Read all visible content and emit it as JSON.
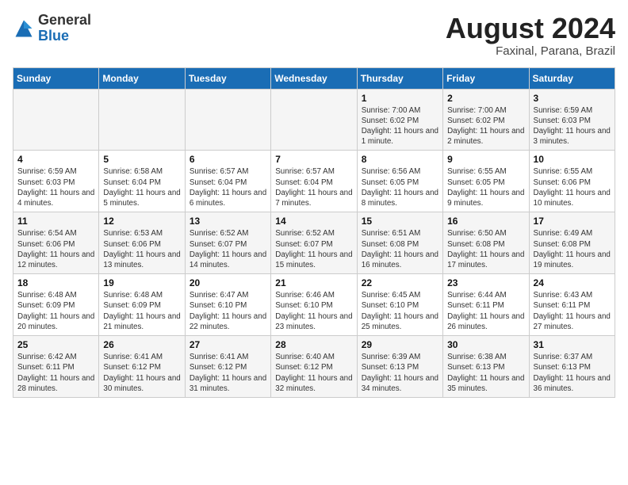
{
  "header": {
    "logo_general": "General",
    "logo_blue": "Blue",
    "title": "August 2024",
    "subtitle": "Faxinal, Parana, Brazil"
  },
  "days_of_week": [
    "Sunday",
    "Monday",
    "Tuesday",
    "Wednesday",
    "Thursday",
    "Friday",
    "Saturday"
  ],
  "weeks": [
    [
      {
        "day": "",
        "info": ""
      },
      {
        "day": "",
        "info": ""
      },
      {
        "day": "",
        "info": ""
      },
      {
        "day": "",
        "info": ""
      },
      {
        "day": "1",
        "info": "Sunrise: 7:00 AM\nSunset: 6:02 PM\nDaylight: 11 hours and 1 minute."
      },
      {
        "day": "2",
        "info": "Sunrise: 7:00 AM\nSunset: 6:02 PM\nDaylight: 11 hours and 2 minutes."
      },
      {
        "day": "3",
        "info": "Sunrise: 6:59 AM\nSunset: 6:03 PM\nDaylight: 11 hours and 3 minutes."
      }
    ],
    [
      {
        "day": "4",
        "info": "Sunrise: 6:59 AM\nSunset: 6:03 PM\nDaylight: 11 hours and 4 minutes."
      },
      {
        "day": "5",
        "info": "Sunrise: 6:58 AM\nSunset: 6:04 PM\nDaylight: 11 hours and 5 minutes."
      },
      {
        "day": "6",
        "info": "Sunrise: 6:57 AM\nSunset: 6:04 PM\nDaylight: 11 hours and 6 minutes."
      },
      {
        "day": "7",
        "info": "Sunrise: 6:57 AM\nSunset: 6:04 PM\nDaylight: 11 hours and 7 minutes."
      },
      {
        "day": "8",
        "info": "Sunrise: 6:56 AM\nSunset: 6:05 PM\nDaylight: 11 hours and 8 minutes."
      },
      {
        "day": "9",
        "info": "Sunrise: 6:55 AM\nSunset: 6:05 PM\nDaylight: 11 hours and 9 minutes."
      },
      {
        "day": "10",
        "info": "Sunrise: 6:55 AM\nSunset: 6:06 PM\nDaylight: 11 hours and 10 minutes."
      }
    ],
    [
      {
        "day": "11",
        "info": "Sunrise: 6:54 AM\nSunset: 6:06 PM\nDaylight: 11 hours and 12 minutes."
      },
      {
        "day": "12",
        "info": "Sunrise: 6:53 AM\nSunset: 6:06 PM\nDaylight: 11 hours and 13 minutes."
      },
      {
        "day": "13",
        "info": "Sunrise: 6:52 AM\nSunset: 6:07 PM\nDaylight: 11 hours and 14 minutes."
      },
      {
        "day": "14",
        "info": "Sunrise: 6:52 AM\nSunset: 6:07 PM\nDaylight: 11 hours and 15 minutes."
      },
      {
        "day": "15",
        "info": "Sunrise: 6:51 AM\nSunset: 6:08 PM\nDaylight: 11 hours and 16 minutes."
      },
      {
        "day": "16",
        "info": "Sunrise: 6:50 AM\nSunset: 6:08 PM\nDaylight: 11 hours and 17 minutes."
      },
      {
        "day": "17",
        "info": "Sunrise: 6:49 AM\nSunset: 6:08 PM\nDaylight: 11 hours and 19 minutes."
      }
    ],
    [
      {
        "day": "18",
        "info": "Sunrise: 6:48 AM\nSunset: 6:09 PM\nDaylight: 11 hours and 20 minutes."
      },
      {
        "day": "19",
        "info": "Sunrise: 6:48 AM\nSunset: 6:09 PM\nDaylight: 11 hours and 21 minutes."
      },
      {
        "day": "20",
        "info": "Sunrise: 6:47 AM\nSunset: 6:10 PM\nDaylight: 11 hours and 22 minutes."
      },
      {
        "day": "21",
        "info": "Sunrise: 6:46 AM\nSunset: 6:10 PM\nDaylight: 11 hours and 23 minutes."
      },
      {
        "day": "22",
        "info": "Sunrise: 6:45 AM\nSunset: 6:10 PM\nDaylight: 11 hours and 25 minutes."
      },
      {
        "day": "23",
        "info": "Sunrise: 6:44 AM\nSunset: 6:11 PM\nDaylight: 11 hours and 26 minutes."
      },
      {
        "day": "24",
        "info": "Sunrise: 6:43 AM\nSunset: 6:11 PM\nDaylight: 11 hours and 27 minutes."
      }
    ],
    [
      {
        "day": "25",
        "info": "Sunrise: 6:42 AM\nSunset: 6:11 PM\nDaylight: 11 hours and 28 minutes."
      },
      {
        "day": "26",
        "info": "Sunrise: 6:41 AM\nSunset: 6:12 PM\nDaylight: 11 hours and 30 minutes."
      },
      {
        "day": "27",
        "info": "Sunrise: 6:41 AM\nSunset: 6:12 PM\nDaylight: 11 hours and 31 minutes."
      },
      {
        "day": "28",
        "info": "Sunrise: 6:40 AM\nSunset: 6:12 PM\nDaylight: 11 hours and 32 minutes."
      },
      {
        "day": "29",
        "info": "Sunrise: 6:39 AM\nSunset: 6:13 PM\nDaylight: 11 hours and 34 minutes."
      },
      {
        "day": "30",
        "info": "Sunrise: 6:38 AM\nSunset: 6:13 PM\nDaylight: 11 hours and 35 minutes."
      },
      {
        "day": "31",
        "info": "Sunrise: 6:37 AM\nSunset: 6:13 PM\nDaylight: 11 hours and 36 minutes."
      }
    ]
  ]
}
